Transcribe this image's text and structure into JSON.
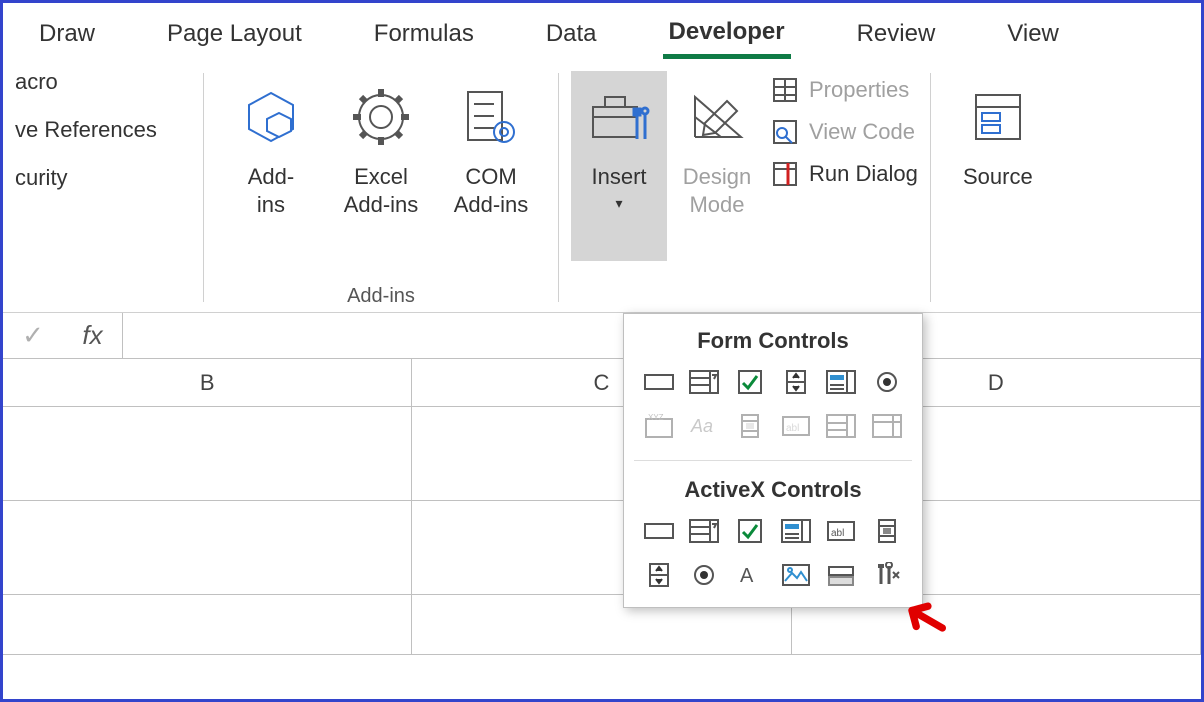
{
  "tabs": {
    "draw": "Draw",
    "page_layout": "Page Layout",
    "formulas": "Formulas",
    "data": "Data",
    "developer": "Developer",
    "review": "Review",
    "view": "View"
  },
  "code_group": {
    "macro": "acro",
    "relative": "ve References",
    "security": "curity"
  },
  "addins_group": {
    "label": "Add-ins",
    "addins": "Add-\nins",
    "excel_addins": "Excel\nAdd-ins",
    "com_addins": "COM\nAdd-ins"
  },
  "controls_group": {
    "insert": "Insert",
    "design_mode": "Design\nMode",
    "properties": "Properties",
    "view_code": "View Code",
    "run_dialog": "Run Dialog"
  },
  "xml_group": {
    "source": "Source"
  },
  "dropdown": {
    "form_title": "Form Controls",
    "activex_title": "ActiveX Controls",
    "form_icons": [
      "button-icon",
      "combobox-icon",
      "checkbox-icon",
      "spin-icon",
      "listbox-icon",
      "option-icon",
      "groupbox-icon",
      "label-icon",
      "scrollbar-icon",
      "textfield-icon",
      "combo-list-icon",
      "combo-drop-icon"
    ],
    "activex_icons": [
      "ax-commandbutton-icon",
      "ax-combobox-icon",
      "ax-checkbox-icon",
      "ax-listbox-icon",
      "ax-textbox-icon",
      "ax-scrollbar-icon",
      "ax-spin-icon",
      "ax-option-icon",
      "ax-label-icon",
      "ax-image-icon",
      "ax-toggle-icon",
      "ax-more-controls-icon"
    ]
  },
  "grid": {
    "columns": [
      "B",
      "C",
      "D"
    ]
  },
  "formula_bar": {
    "fx": "fx",
    "value": ""
  }
}
